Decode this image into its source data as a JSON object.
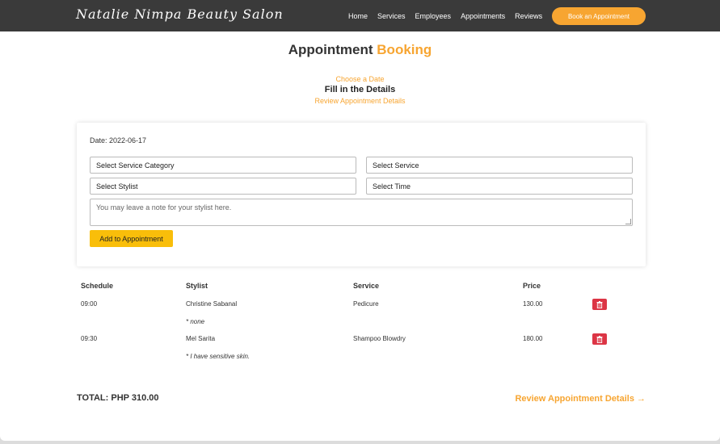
{
  "nav": {
    "brand": "Natalie Nimpa Beauty Salon",
    "links": [
      "Home",
      "Services",
      "Employees",
      "Appointments",
      "Reviews"
    ],
    "cta": "Book an Appointment"
  },
  "header": {
    "title_main": "Appointment",
    "title_accent": "Booking",
    "steps": [
      "Choose a Date",
      "Fill in the Details",
      "Review Appointment Details"
    ]
  },
  "form": {
    "date_label": "Date: 2022-06-17",
    "service_category": "Select Service Category",
    "service": "Select Service",
    "stylist": "Select Stylist",
    "time": "Select Time",
    "note_placeholder": "You may leave a note for your stylist here.",
    "add_button": "Add to Appointment"
  },
  "table": {
    "headers": [
      "Schedule",
      "Stylist",
      "Service",
      "Price"
    ],
    "rows": [
      {
        "schedule": "09:00",
        "stylist": "Christine Sabanal",
        "service": "Pedicure",
        "price": "130.00",
        "note": "* none"
      },
      {
        "schedule": "09:30",
        "stylist": "Mel Sarita",
        "service": "Shampoo Blowdry",
        "price": "180.00",
        "note": "* I have sensitive skin."
      }
    ]
  },
  "footer": {
    "total": "TOTAL: PHP 310.00",
    "review_link": "Review Appointment Details →"
  },
  "colors": {
    "accent": "#f7a531",
    "button_yellow": "#f9be0a",
    "delete_red": "#dc3545",
    "nav_bg": "#3a3a3a"
  }
}
